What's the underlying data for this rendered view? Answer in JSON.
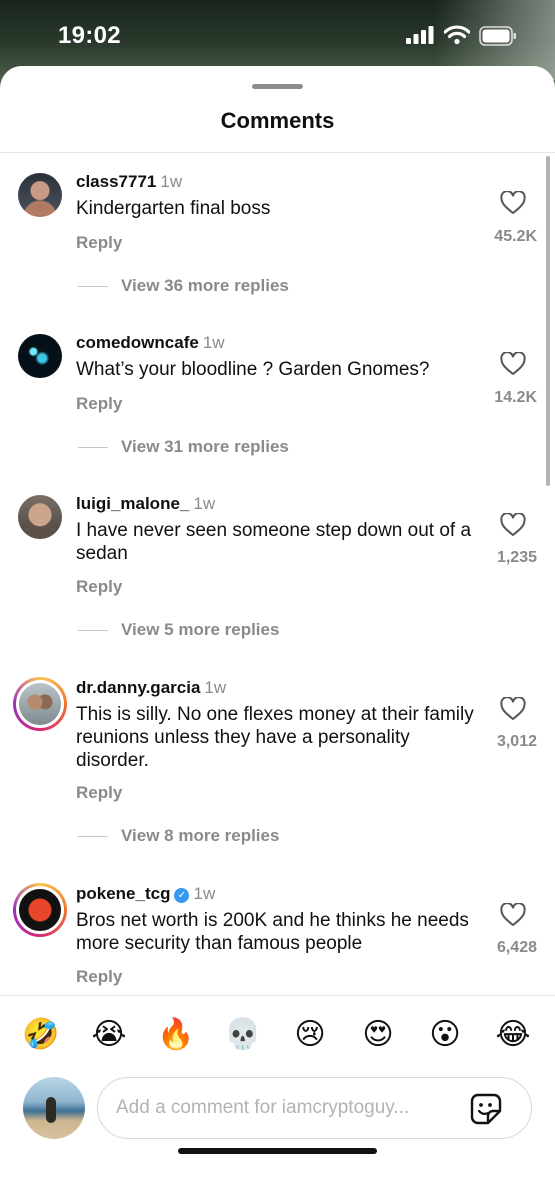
{
  "status_bar": {
    "time": "19:02"
  },
  "sheet": {
    "title": "Comments"
  },
  "comments": [
    {
      "username": "class7771",
      "age": "1w",
      "verified": false,
      "text": "Kindergarten final boss",
      "reply_label": "Reply",
      "likes": "45.2K",
      "view_replies": "View 36 more replies"
    },
    {
      "username": "comedowncafe",
      "age": "1w",
      "verified": false,
      "text": "What’s your bloodline ? Garden Gnomes?",
      "reply_label": "Reply",
      "likes": "14.2K",
      "view_replies": "View 31 more replies"
    },
    {
      "username": "luigi_malone_",
      "age": "1w",
      "verified": false,
      "text": "I have never seen someone step down out of a sedan",
      "reply_label": "Reply",
      "likes": "1,235",
      "view_replies": "View 5 more replies"
    },
    {
      "username": "dr.danny.garcia",
      "age": "1w",
      "verified": false,
      "text": "This is silly. No one flexes money at their family reunions unless they have a personality disorder.",
      "reply_label": "Reply",
      "likes": "3,012",
      "view_replies": "View 8 more replies"
    },
    {
      "username": "pokene_tcg",
      "age": "1w",
      "verified": true,
      "text": "Bros net worth is 200K and he thinks he needs more security than famous people",
      "reply_label": "Reply",
      "likes": "6,428"
    }
  ],
  "quick_reactions": [
    "🤣",
    "😭",
    "🔥",
    "💀",
    "😢",
    "😍",
    "😮",
    "😂"
  ],
  "composer": {
    "placeholder": "Add a comment for iamcryptoguy..."
  },
  "colors": {
    "muted_text": "#8a8a8a",
    "verified_blue": "#3897f0",
    "divider": "#e6e6e6"
  }
}
